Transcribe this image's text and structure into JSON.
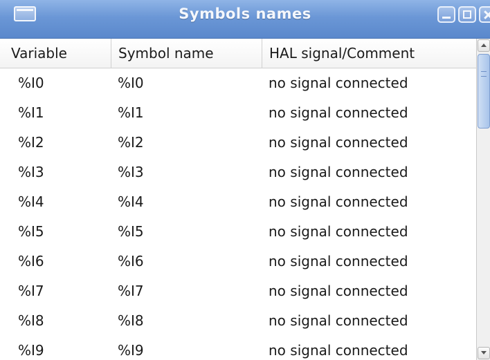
{
  "window": {
    "title": "Symbols names"
  },
  "titlebar": {
    "icons": [
      "window-menu-icon",
      "minimize-icon",
      "maximize-icon",
      "close-icon"
    ]
  },
  "table": {
    "columns": [
      "Variable",
      "Symbol name",
      "HAL signal/Comment"
    ],
    "rows": [
      [
        "%I0",
        "%I0",
        "no signal connected"
      ],
      [
        "%I1",
        "%I1",
        "no signal connected"
      ],
      [
        "%I2",
        "%I2",
        "no signal connected"
      ],
      [
        "%I3",
        "%I3",
        "no signal connected"
      ],
      [
        "%I4",
        "%I4",
        "no signal connected"
      ],
      [
        "%I5",
        "%I5",
        "no signal connected"
      ],
      [
        "%I6",
        "%I6",
        "no signal connected"
      ],
      [
        "%I7",
        "%I7",
        "no signal connected"
      ],
      [
        "%I8",
        "%I8",
        "no signal connected"
      ],
      [
        "%I9",
        "%I9",
        "no signal connected"
      ]
    ]
  },
  "colors": {
    "titlebar": "#6b97d6",
    "title_text": "#f4f7fc",
    "scroll_thumb": "#a8c4ea"
  }
}
